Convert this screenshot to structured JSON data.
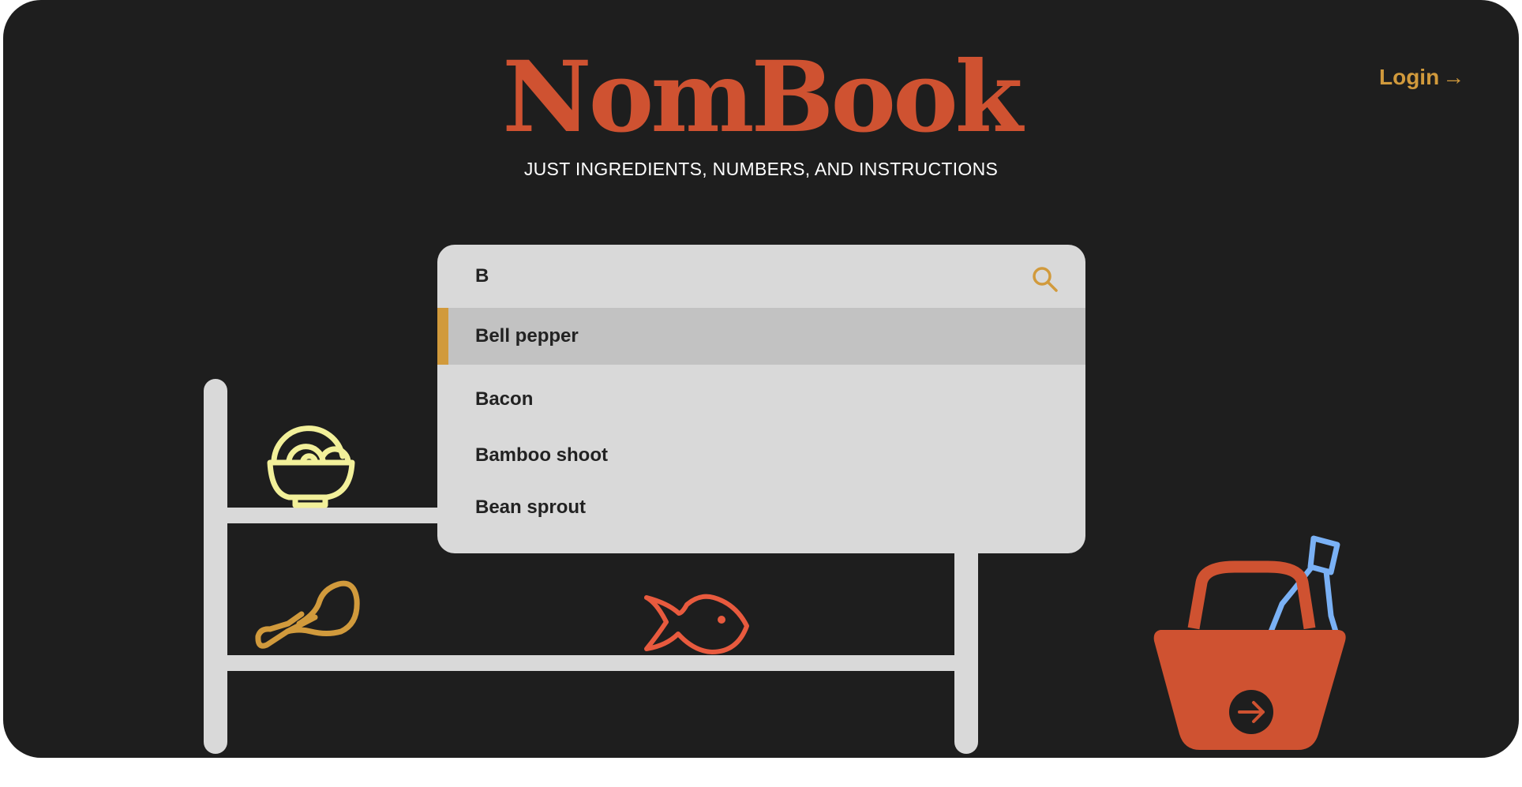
{
  "app": {
    "title": "NomBook",
    "tagline": "JUST INGREDIENTS, NUMBERS, AND INSTRUCTIONS"
  },
  "header": {
    "login_label": "Login",
    "login_arrow": "→"
  },
  "search": {
    "value": "B",
    "suggestions": [
      {
        "label": "Bell pepper",
        "highlighted": true
      },
      {
        "label": "Bacon",
        "highlighted": false
      },
      {
        "label": "Bamboo shoot",
        "highlighted": false
      },
      {
        "label": "Bean sprout",
        "highlighted": false
      }
    ]
  },
  "colors": {
    "background": "#1e1e1e",
    "brand": "#cf5231",
    "accent": "#d19a3c",
    "panel": "#d9d9d9",
    "highlight_row": "#c2c2c2",
    "shelf": "#d9d9d9",
    "bowl": "#f2f09a",
    "bottle": "#7ab1f5"
  },
  "icons": [
    "search-icon",
    "bowl-icon",
    "chicken-leg-icon",
    "fish-icon",
    "basket-icon",
    "bottle-icon",
    "arrow-right-icon"
  ]
}
